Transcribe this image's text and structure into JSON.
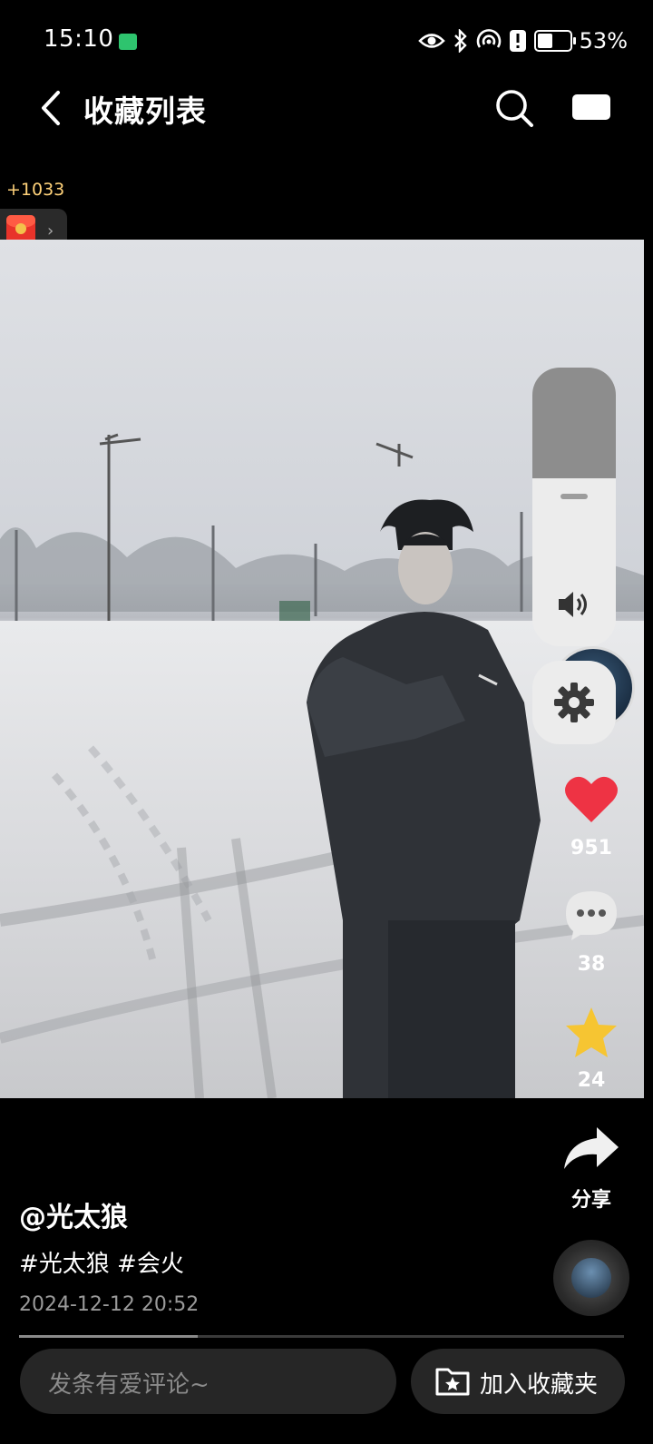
{
  "status_bar": {
    "time": "15:10",
    "battery": "53%",
    "battery_level": 0.53,
    "icons": [
      "eye-icon",
      "bluetooth-icon",
      "hotspot-icon",
      "alert-icon",
      "battery-icon"
    ]
  },
  "header": {
    "title": "收藏列表",
    "icons": [
      "back-arrow-icon",
      "search-icon",
      "video-icon"
    ]
  },
  "reward": {
    "coins": "+1033",
    "chevron": "›",
    "icon": "red-envelope-icon"
  },
  "video": {
    "overlay_emojis": "❤️🤙💞🎼✌🏿🤡🐊🚬"
  },
  "rail": {
    "volume_level": 0.4,
    "likes": "951",
    "comments": "38",
    "favorites": "24",
    "share_label": "分享",
    "colors": {
      "like": "#ee3344",
      "favorite": "#f6c532"
    }
  },
  "caption": {
    "author": "@光太狼",
    "hashtags": "#光太狼 #会火",
    "posted_at": "2024-12-12 20:52",
    "playback_progress": 0.295
  },
  "bottom_bar": {
    "comment_placeholder": "发条有爱评论~",
    "collect_label": "加入收藏夹"
  }
}
